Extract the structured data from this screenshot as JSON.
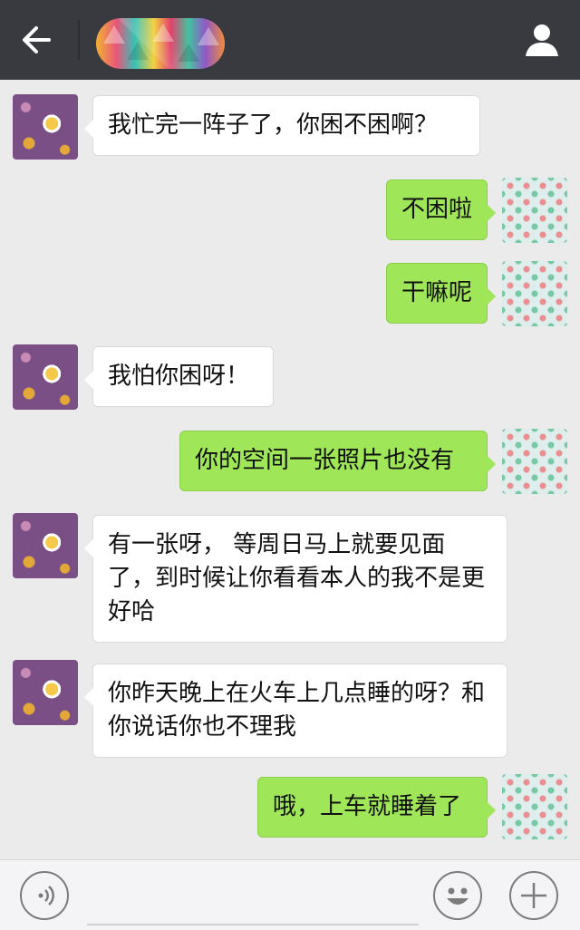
{
  "header": {
    "back_icon": "arrow-left-icon",
    "profile_icon": "user-icon",
    "background": "#393a3f"
  },
  "messages": [
    {
      "side": "left",
      "text": "我忙完一阵子了，你困不困啊？"
    },
    {
      "side": "right",
      "text": "不困啦"
    },
    {
      "side": "right",
      "text": "干嘛呢"
    },
    {
      "side": "left",
      "text": "我怕你困呀！"
    },
    {
      "side": "right",
      "text": "你的空间一张照片也没有"
    },
    {
      "side": "left",
      "text": "有一张呀， 等周日马上就要见面了，到时候让你看看本人的我不是更好哈"
    },
    {
      "side": "left",
      "text": "你昨天晚上在火车上几点睡的呀？和你说话你也不理我"
    },
    {
      "side": "right",
      "text": "哦，上车就睡着了"
    }
  ],
  "bottom_bar": {
    "voice_icon": "voice-icon",
    "emoji_icon": "smiley-icon",
    "plus_icon": "plus-icon"
  },
  "colors": {
    "chat_bg": "#ebebeb",
    "right_bubble": "#9fe658",
    "left_bubble": "#ffffff"
  }
}
